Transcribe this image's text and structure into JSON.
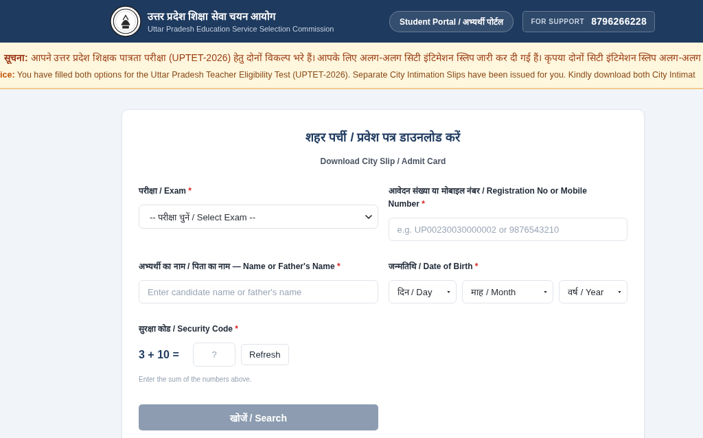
{
  "header": {
    "title": "उत्तर प्रदेश शिक्षा सेवा चयन आयोग",
    "subtitle": "Uttar Pradesh Education Service Selection Commission",
    "portal_link": "Student Portal / अभ्यर्थी पोर्टल",
    "support": {
      "label": "FOR SUPPORT",
      "phone": "8796266228"
    }
  },
  "notice": {
    "lines": [
      {
        "text": "**सूचना:** आपने उत्तर प्रदेश शिक्षक पात्रता परीक्षा (UPTET-2026) हेतु दोनों विकल्प भरे हैं। आपके लिए अलग-अलग सिटी इंटिमेशन स्लिप जारी कर दी गई हैं। कृपया दोनों सिटी इंटिमेशन स्लिप अलग-अलग"
      },
      {
        "text": "**ice:** You have filled both options for the Uttar Pradesh Teacher Eligibility Test (UPTET-2026). Separate City Intimation Slips have been issued for you. Kindly download both City Intimat"
      }
    ]
  },
  "card": {
    "title": "शहर पर्ची / प्रवेश पत्र डाउनलोड करें",
    "subtitle": "Download City Slip / Admit Card"
  },
  "form": {
    "fields": [
      {
        "kind": "select",
        "label": "परीक्षा / Exam",
        "mark": "*",
        "value": "-- परीक्षा चुनें / Select Exam --"
      },
      {
        "kind": "input",
        "label": "आवेदन संख्या या मोबाइल नंबर / Registration No or Mobile Number",
        "mark": "*",
        "placeholder": "e.g. UP00230030000002 or 9876543210"
      },
      {
        "kind": "input",
        "label": "अभ्यर्थी का नाम / पिता का नाम — Name or Father's Name",
        "mark": "*",
        "placeholder": "Enter candidate name or father's name"
      },
      {
        "kind": "date",
        "label": "जन्मतिथि / Date of Birth",
        "mark": "*",
        "parts": [
          "दिन / Day",
          "माह / Month",
          "वर्ष / Year"
        ]
      },
      {
        "kind": "captcha",
        "label": "सुरक्षा कोड / Security Code",
        "mark": "*",
        "question": "3 + 10 =",
        "placeholder": "?",
        "button": "Refresh",
        "hint": "Enter the sum of the numbers above."
      }
    ],
    "submit": {
      "label": "खोजें / Search",
      "disabled": true
    }
  }
}
